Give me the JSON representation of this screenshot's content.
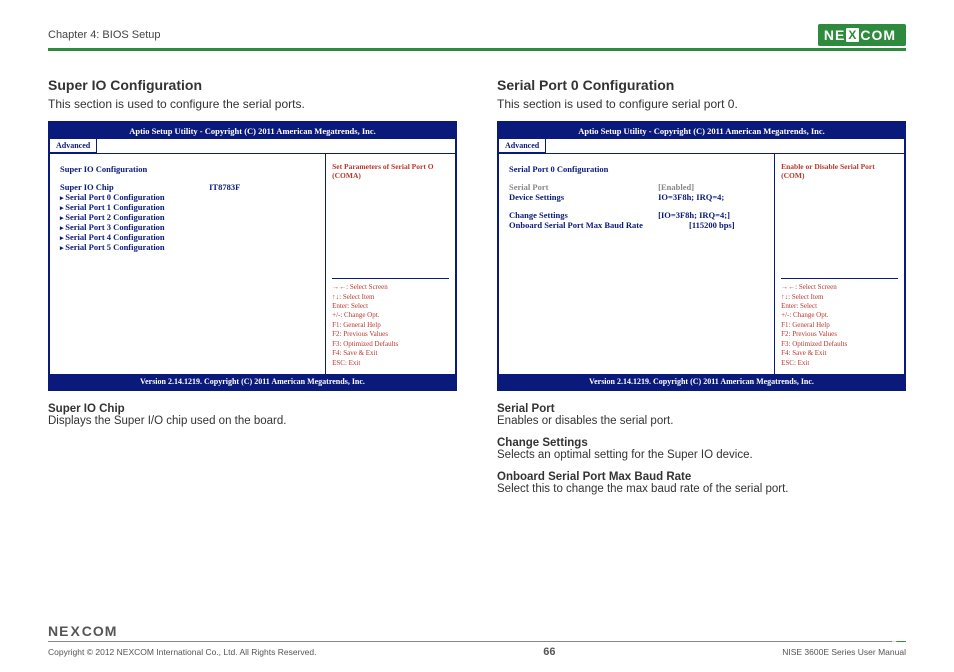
{
  "header": {
    "chapter": "Chapter 4: BIOS Setup",
    "brand": "NEXCOM"
  },
  "left": {
    "title": "Super IO Configuration",
    "subtitle": "This section is used to configure the serial ports.",
    "bios": {
      "top": "Aptio Setup Utility - Copyright (C) 2011 American Megatrends, Inc.",
      "tab": "Advanced",
      "heading": "Super IO Configuration",
      "chip_label": "Super IO Chip",
      "chip_value": "IT8783F",
      "items": [
        "Serial Port 0 Configuration",
        "Serial Port 1 Configuration",
        "Serial Port 2 Configuration",
        "Serial Port 3 Configuration",
        "Serial Port 4 Configuration",
        "Serial Port 5 Configuration"
      ],
      "help_top": "Set Parameters of Serial Port O (COMA)",
      "help": [
        "→←: Select Screen",
        "↑↓: Select Item",
        "Enter: Select",
        "+/-: Change Opt.",
        "F1: General Help",
        "F2: Previous Values",
        "F3: Optimized Defaults",
        "F4: Save & Exit",
        "ESC: Exit"
      ],
      "footer": "Version 2.14.1219. Copyright (C) 2011 American Megatrends, Inc."
    },
    "desc1_title": "Super IO Chip",
    "desc1_body": "Displays the Super I/O chip used on the board."
  },
  "right": {
    "title": "Serial Port 0 Configuration",
    "subtitle": "This section is used to configure serial port 0.",
    "bios": {
      "top": "Aptio Setup Utility - Copyright (C) 2011 American Megatrends, Inc.",
      "tab": "Advanced",
      "heading": "Serial Port 0 Configuration",
      "rows": [
        {
          "label": "Serial Port",
          "value": "[Enabled]",
          "grey": true
        },
        {
          "label": "Device Settings",
          "value": "IO=3F8h; IRQ=4;",
          "grey": false
        }
      ],
      "rows2": [
        {
          "label": "Change Settings",
          "value": "[IO=3F8h; IRQ=4;]"
        },
        {
          "label": "Onboard Serial Port Max Baud Rate",
          "value": "[115200 bps]"
        }
      ],
      "help_top": "Enable or Disable Serial Port (COM)",
      "help": [
        "→←: Select Screen",
        "↑↓: Select Item",
        "Enter: Select",
        "+/-: Change Opt.",
        "F1: General Help",
        "F2: Previous Values",
        "F3: Optimized Defaults",
        "F4: Save & Exit",
        "ESC: Exit"
      ],
      "footer": "Version 2.14.1219. Copyright (C) 2011 American Megatrends, Inc."
    },
    "desc1_title": "Serial Port",
    "desc1_body": "Enables or disables the serial port.",
    "desc2_title": "Change Settings",
    "desc2_body": "Selects an optimal setting for the Super IO device.",
    "desc3_title": "Onboard Serial Port Max Baud Rate",
    "desc3_body": "Select this to change the max baud rate of the serial port."
  },
  "footer": {
    "copyright": "Copyright © 2012 NEXCOM International Co., Ltd. All Rights Reserved.",
    "page": "66",
    "manual": "NISE 3600E Series User Manual"
  }
}
